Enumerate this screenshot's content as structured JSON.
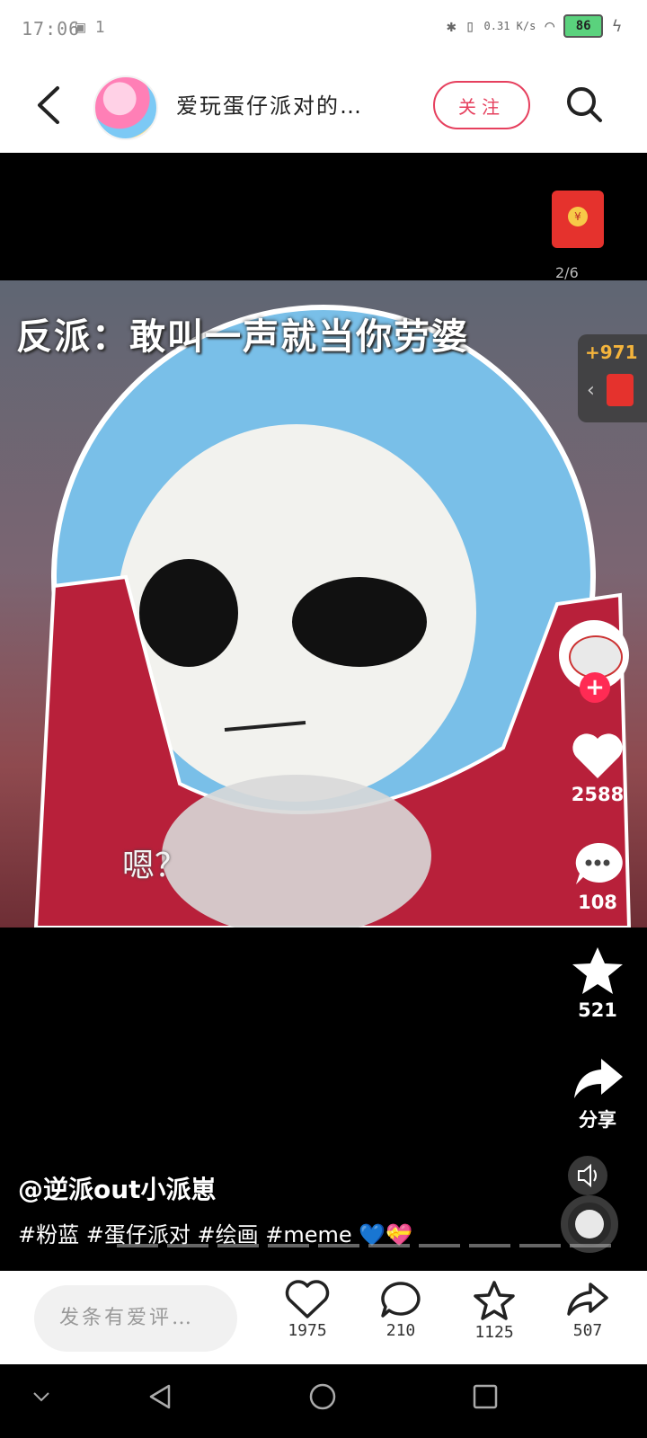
{
  "status_bar": {
    "time": "17:06",
    "notify_count": "1",
    "net_speed": "0.31 K/s",
    "battery": "86"
  },
  "header": {
    "author_name": "爱玩蛋仔派对的…",
    "follow_label": "关注"
  },
  "video": {
    "caption_top": "反派：敢叫一声就当你劳婆",
    "caption_bottom": "嗯？",
    "page_indicator": "2/6",
    "reward_amount": "+971",
    "red_packet_icon": "red-packet-icon"
  },
  "right_rail": {
    "likes": "2588",
    "comments": "108",
    "favorites": "521",
    "share_label": "分享"
  },
  "description": {
    "username": "@逆派out小派崽",
    "tags": "#粉蓝 #蛋仔派对 #绘画 #meme 💙💝"
  },
  "bottom_bar": {
    "comment_placeholder": "发条有爱评…",
    "likes": "1975",
    "comments": "210",
    "favorites": "1125",
    "shares": "507"
  },
  "colors": {
    "accent": "#e6405e",
    "plus_badge": "#ff2b54",
    "reward_gold": "#f4b43c"
  }
}
